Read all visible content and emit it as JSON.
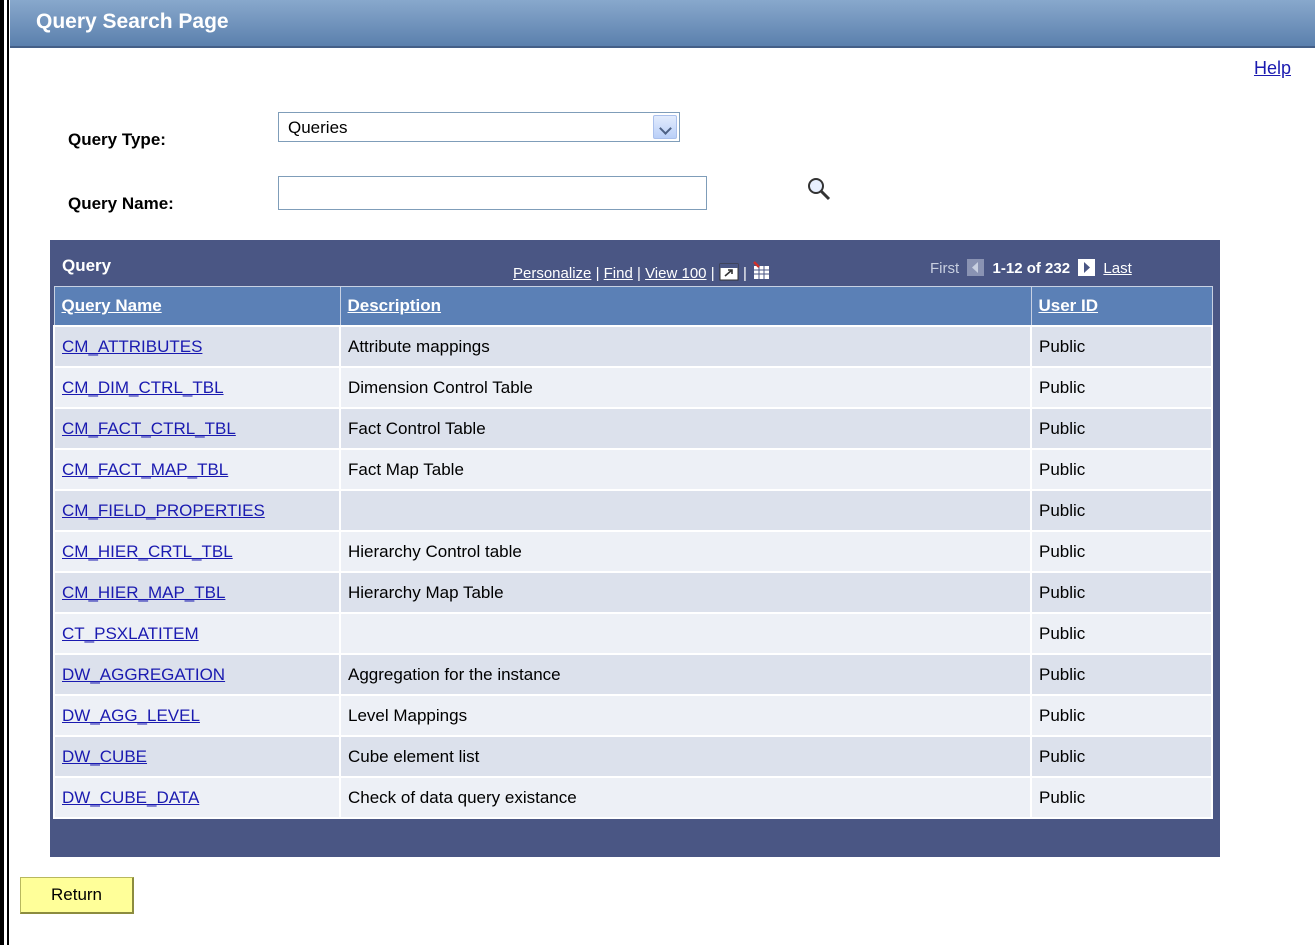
{
  "page": {
    "title": "Query Search Page",
    "help_label": "Help"
  },
  "form": {
    "query_type_label": "Query Type:",
    "query_type_value": "Queries",
    "query_name_label": "Query Name:",
    "query_name_value": ""
  },
  "grid": {
    "title": "Query",
    "links": {
      "personalize": "Personalize",
      "find": "Find",
      "view100": "View 100"
    },
    "pager": {
      "first": "First",
      "range": "1-12 of 232",
      "last": "Last"
    },
    "columns": [
      "Query Name",
      "Description",
      "User ID"
    ],
    "rows": [
      {
        "name": "CM_ATTRIBUTES",
        "description": "Attribute mappings",
        "user": "Public"
      },
      {
        "name": "CM_DIM_CTRL_TBL",
        "description": "Dimension Control Table",
        "user": "Public"
      },
      {
        "name": "CM_FACT_CTRL_TBL",
        "description": "Fact Control Table",
        "user": "Public"
      },
      {
        "name": "CM_FACT_MAP_TBL",
        "description": "Fact Map Table",
        "user": "Public"
      },
      {
        "name": "CM_FIELD_PROPERTIES",
        "description": "",
        "user": "Public"
      },
      {
        "name": "CM_HIER_CRTL_TBL",
        "description": "Hierarchy Control table",
        "user": "Public"
      },
      {
        "name": "CM_HIER_MAP_TBL",
        "description": "Hierarchy Map Table",
        "user": "Public"
      },
      {
        "name": "CT_PSXLATITEM",
        "description": "",
        "user": "Public"
      },
      {
        "name": "DW_AGGREGATION",
        "description": "Aggregation for the instance",
        "user": "Public"
      },
      {
        "name": "DW_AGG_LEVEL",
        "description": "Level Mappings",
        "user": "Public"
      },
      {
        "name": "DW_CUBE",
        "description": "Cube element list",
        "user": "Public"
      },
      {
        "name": "DW_CUBE_DATA",
        "description": "Check of data query existance",
        "user": "Public"
      }
    ]
  },
  "buttons": {
    "return_label": "Return"
  },
  "icons": {
    "lookup": "magnifier-icon",
    "zoom": "new-window-icon",
    "download": "grid-download-icon",
    "prev": "arrow-left-icon",
    "next": "arrow-right-icon"
  }
}
